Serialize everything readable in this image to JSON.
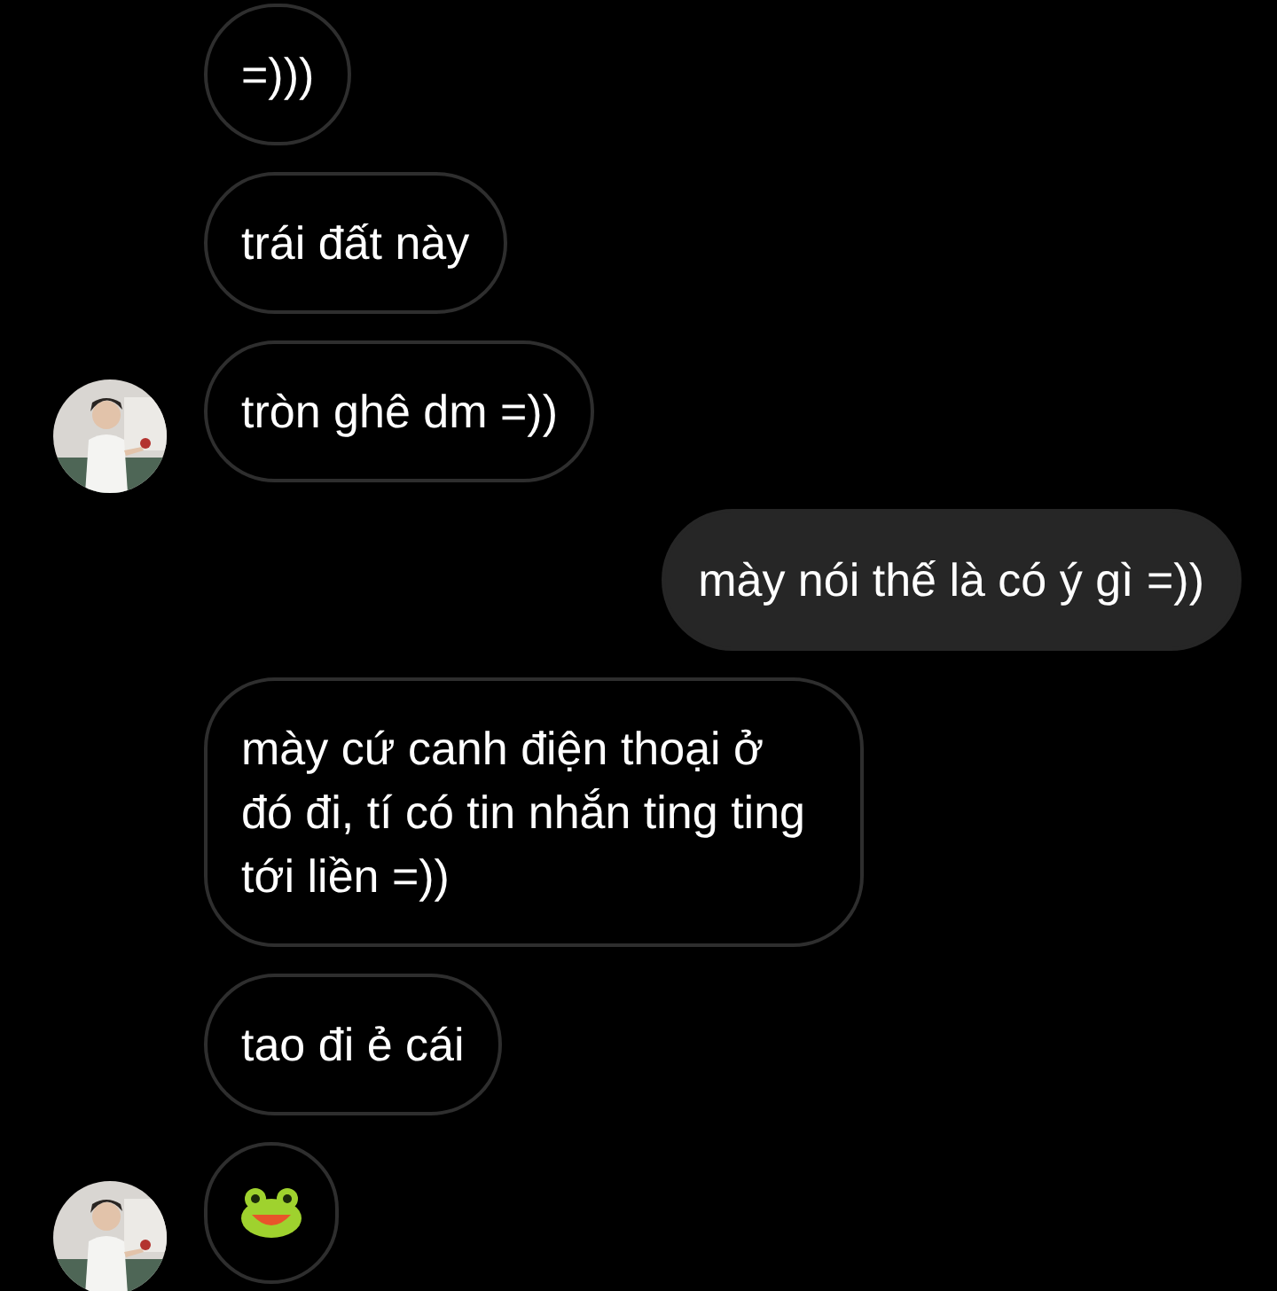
{
  "messages": [
    {
      "kind": "text",
      "outgoing": false,
      "avatar": false,
      "text": "=)))"
    },
    {
      "kind": "text",
      "outgoing": false,
      "avatar": false,
      "text": "trái đất này"
    },
    {
      "kind": "text",
      "outgoing": false,
      "avatar": true,
      "text": "tròn ghê dm =))"
    },
    {
      "kind": "text",
      "outgoing": true,
      "avatar": false,
      "text": "mày nói thế là có ý gì =))"
    },
    {
      "kind": "text",
      "outgoing": false,
      "avatar": false,
      "text": "mày cứ canh điện thoại ở đó đi, tí có tin nhắn ting ting tới liền =))"
    },
    {
      "kind": "text",
      "outgoing": false,
      "avatar": false,
      "text": "tao đi ẻ cái"
    },
    {
      "kind": "sticker",
      "outgoing": false,
      "avatar": true
    }
  ]
}
